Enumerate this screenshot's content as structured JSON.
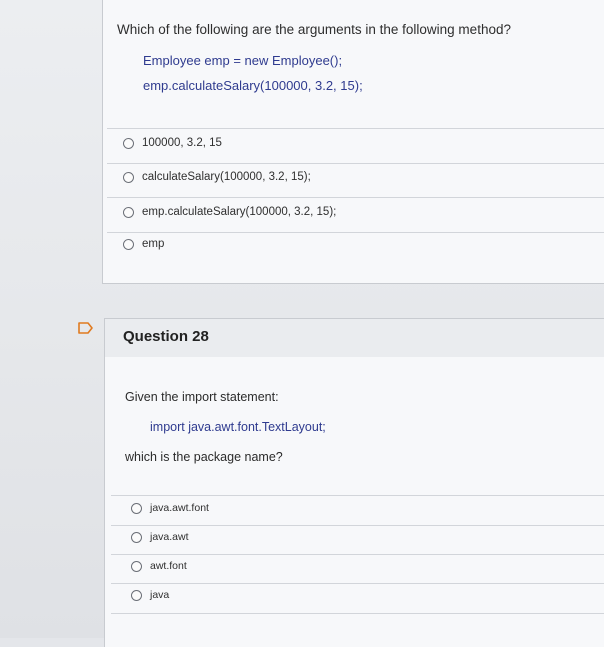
{
  "question27": {
    "prompt": "Which of the following are the arguments in the following method?",
    "code_lines": [
      "Employee emp = new Employee();",
      "emp.calculateSalary(100000, 3.2, 15);"
    ],
    "options": [
      "100000, 3.2, 15",
      "calculateSalary(100000, 3.2, 15);",
      "emp.calculateSalary(100000, 3.2, 15);",
      "emp"
    ]
  },
  "question28": {
    "title": "Question 28",
    "intro": "Given the import statement:",
    "code": "import java.awt.font.TextLayout;",
    "prompt": "which is the package name?",
    "options": [
      "java.awt.font",
      "java.awt",
      "awt.font",
      "java"
    ]
  },
  "icons": {
    "flag": "flag-icon",
    "radio": "radio-button-icon"
  },
  "colors": {
    "code_text": "#2f3b8f",
    "background": "#e4e6ea",
    "card": "#f7f8fa"
  }
}
